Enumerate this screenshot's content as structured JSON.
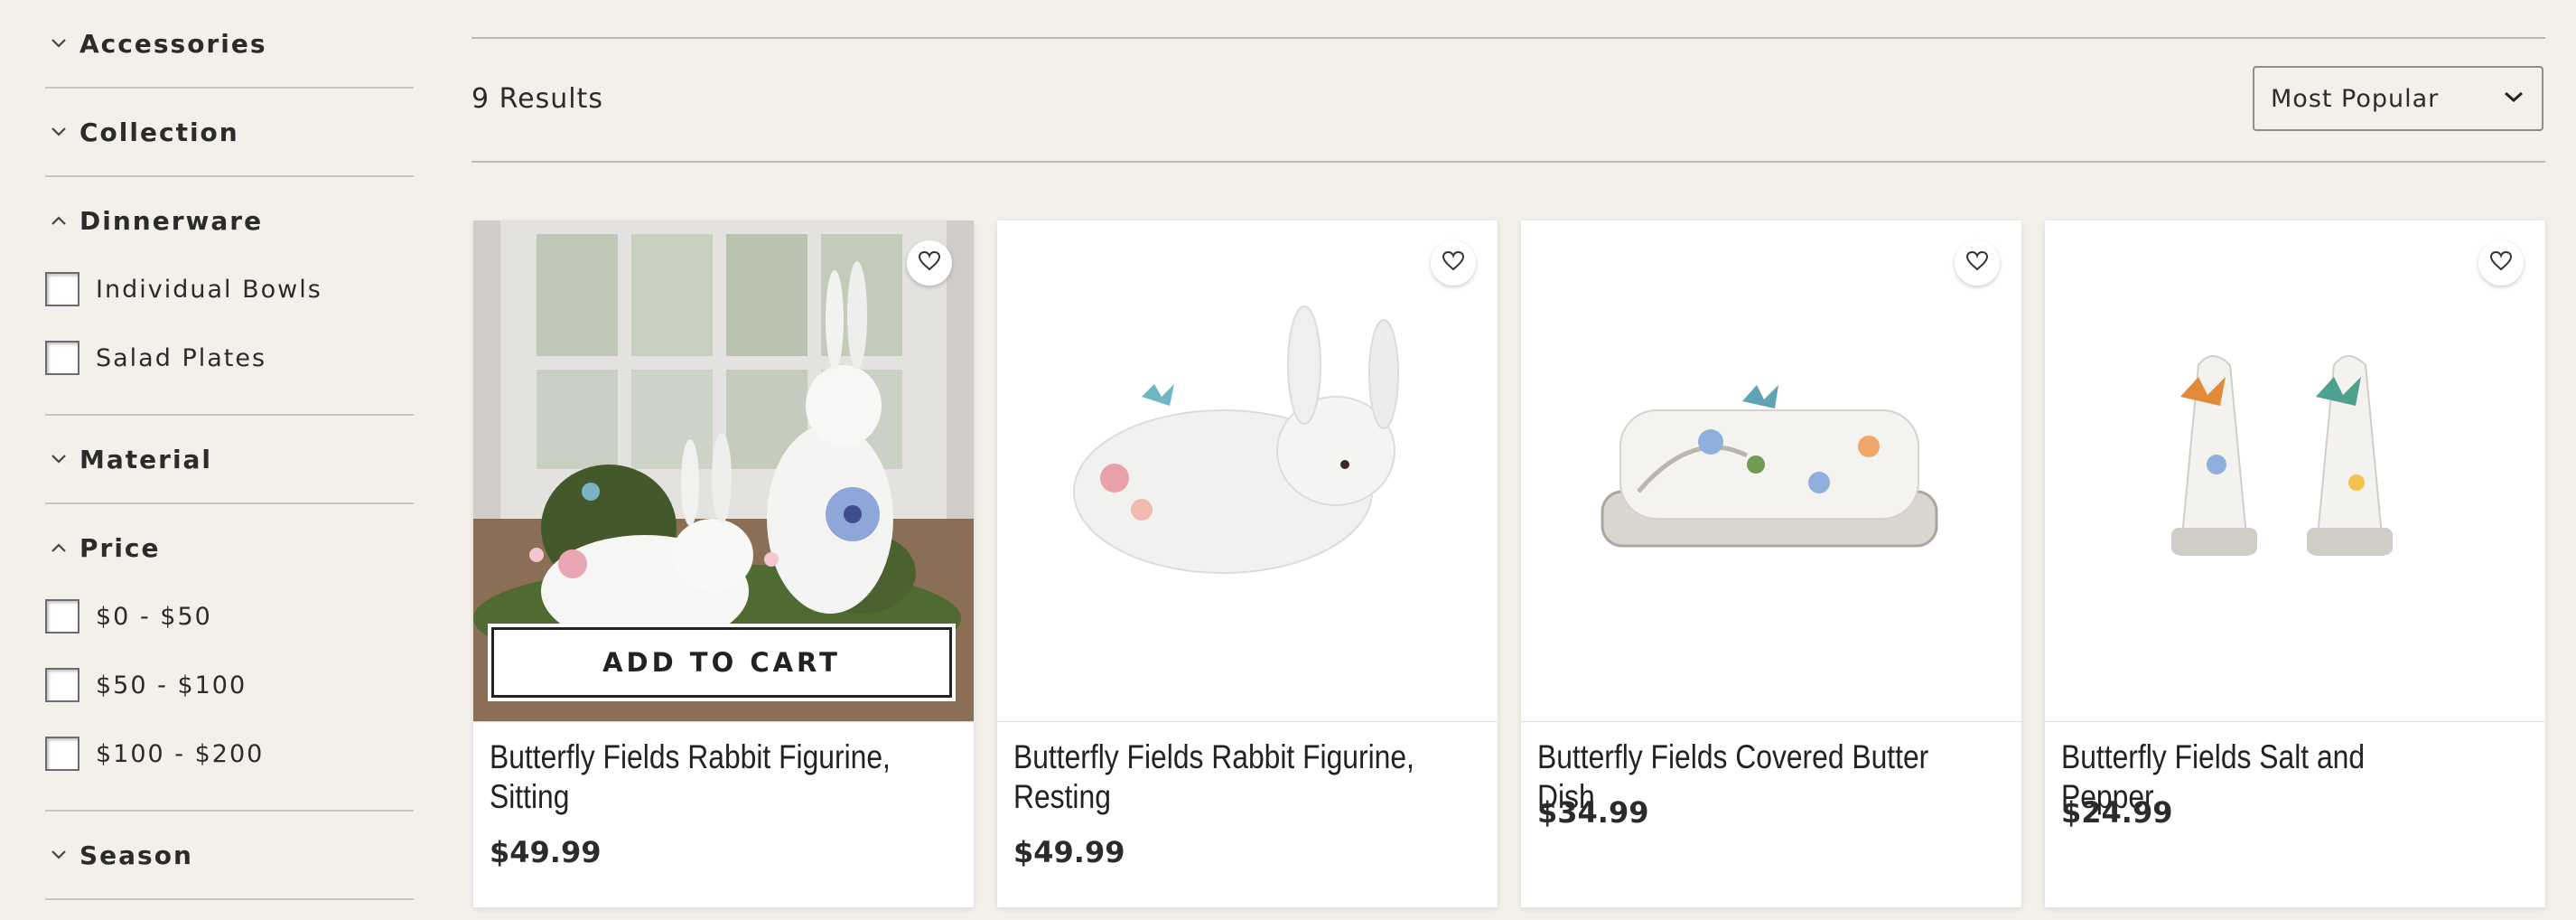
{
  "sidebar": {
    "facets": [
      {
        "title": "Accessories",
        "expanded": false,
        "options": []
      },
      {
        "title": "Collection",
        "expanded": false,
        "options": []
      },
      {
        "title": "Dinnerware",
        "expanded": true,
        "options": [
          "Individual Bowls",
          "Salad Plates"
        ]
      },
      {
        "title": "Material",
        "expanded": false,
        "options": []
      },
      {
        "title": "Price",
        "expanded": true,
        "options": [
          "$0 - $50",
          "$50 - $100",
          "$100 - $200"
        ]
      },
      {
        "title": "Season",
        "expanded": false,
        "options": []
      }
    ]
  },
  "results": {
    "count_label": "9 Results"
  },
  "sort": {
    "selected": "Most Popular"
  },
  "products": [
    {
      "name": "Butterfly Fields Rabbit Figurine, Sitting",
      "price": "$49.99",
      "add_to_cart": "ADD TO CART"
    },
    {
      "name": "Butterfly Fields Rabbit Figurine, Resting",
      "price": "$49.99"
    },
    {
      "name": "Butterfly Fields Covered Butter Dish",
      "price": "$34.99"
    },
    {
      "name": "Butterfly Fields Salt and Pepper",
      "price": "$24.99"
    }
  ],
  "icons": {
    "wishlist": "heart-icon",
    "collapse": "chevron-down-icon",
    "expand": "chevron-up-icon",
    "sort": "chevron-down-icon"
  },
  "colors": {
    "background": "#f3f0ea",
    "card": "#ffffff",
    "text": "#2b2b2b",
    "divider": "#c9c6c0"
  }
}
